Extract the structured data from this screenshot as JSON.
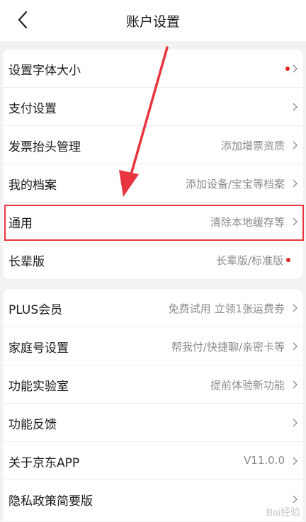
{
  "header": {
    "title": "账户设置",
    "back_icon": "chevron-left-icon"
  },
  "section1": [
    {
      "label": "设置字体大小",
      "value": "",
      "red_dot": true
    },
    {
      "label": "支付设置",
      "value": ""
    },
    {
      "label": "发票抬头管理",
      "value": "添加增票资质"
    },
    {
      "label": "我的档案",
      "value": "添加设备/宝宝等档案"
    },
    {
      "label": "通用",
      "value": "清除本地缓存等",
      "highlighted": true
    },
    {
      "label": "长辈版",
      "value": "长辈版/标准版",
      "red_dot": true
    }
  ],
  "section2": [
    {
      "label": "PLUS会员",
      "value": "免费试用 立领1张运费券"
    },
    {
      "label": "家庭号设置",
      "value": "帮我付/快捷聊/亲密卡等"
    },
    {
      "label": "功能实验室",
      "value": "提前体验新功能"
    },
    {
      "label": "功能反馈",
      "value": ""
    },
    {
      "label": "关于京东APP",
      "value": "V11.0.0"
    },
    {
      "label": "隐私政策简要版",
      "value": ""
    }
  ],
  "colors": {
    "background": "#f2f2f2",
    "card": "#ffffff",
    "accent_red": "#e2231a",
    "annotation_red": "#e8343e",
    "secondary_text": "#8a8a8a"
  },
  "watermark": "Bai经验"
}
